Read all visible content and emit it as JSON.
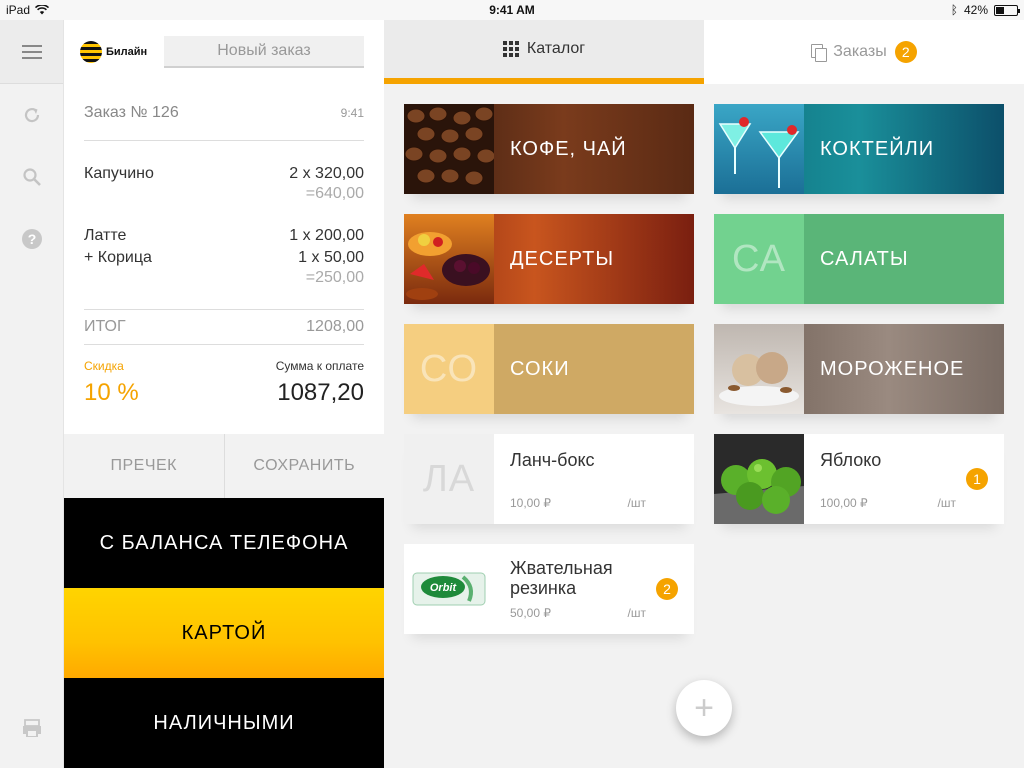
{
  "status_bar": {
    "device": "iPad",
    "time": "9:41 AM",
    "battery": "42%",
    "battery_level": 0.42
  },
  "brand": {
    "name": "Билайн"
  },
  "order_panel": {
    "new_order_tab": "Новый заказ",
    "title": "Заказ № 126",
    "time": "9:41",
    "items": [
      {
        "name": "Капучино",
        "qty_price": "2 x 320,00",
        "subtotal": "=640,00"
      },
      {
        "name": "Латте",
        "qty_price": "1 x 200,00",
        "addon_name": "+ Корица",
        "addon_qty_price": "1 x 50,00",
        "subtotal": "=250,00"
      }
    ],
    "total_label": "ИТОГ",
    "total_value": "1208,00",
    "discount_label": "Скидка",
    "discount_value": "10 %",
    "due_label": "Сумма к оплате",
    "due_value": "1087,20",
    "precheck_label": "ПРЕЧЕК",
    "save_label": "СОХРАНИТЬ",
    "pay_phone_label": "С БАЛАНСА ТЕЛЕФОНА",
    "pay_card_label": "КАРТОЙ",
    "pay_cash_label": "НАЛИЧНЫМИ"
  },
  "tabs": {
    "catalog_label": "Каталог",
    "orders_label": "Заказы",
    "orders_count": "2"
  },
  "categories": [
    {
      "label": "КОФЕ, ЧАЙ",
      "icon": "coffee-beans-image"
    },
    {
      "label": "КОКТЕЙЛИ",
      "icon": "cocktails-image"
    },
    {
      "label": "ДЕСЕРТЫ",
      "icon": "desserts-image"
    },
    {
      "label": "САЛАТЫ",
      "abbr": "СА"
    },
    {
      "label": "СОКИ",
      "abbr": "СО"
    },
    {
      "label": "МОРОЖЕНОЕ",
      "icon": "ice-cream-image"
    }
  ],
  "products": [
    {
      "name": "Ланч-бокс",
      "abbr": "ЛА",
      "price": "10,00 ₽",
      "unit": "/шт"
    },
    {
      "name": "Яблоко",
      "price": "100,00 ₽",
      "unit": "/шт",
      "count": "1",
      "icon": "apples-image"
    },
    {
      "name": "Жвательная резинка",
      "price": "50,00 ₽",
      "unit": "/шт",
      "count": "2",
      "icon": "orbit-gum-image",
      "image_text": "Orbit"
    }
  ],
  "colors": {
    "accent": "#f5a300",
    "brand_yellow": "#ffc400"
  }
}
